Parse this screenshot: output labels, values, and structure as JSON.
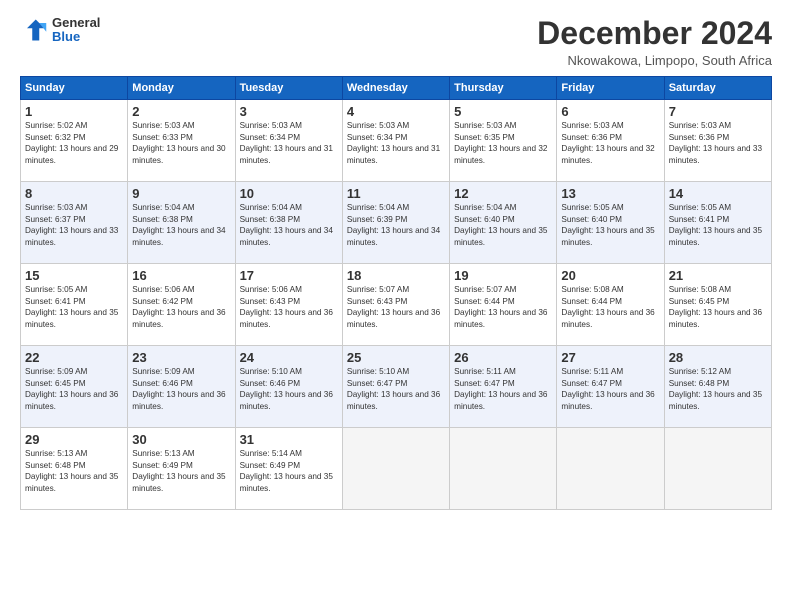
{
  "logo": {
    "general": "General",
    "blue": "Blue"
  },
  "title": "December 2024",
  "location": "Nkowakowa, Limpopo, South Africa",
  "headers": [
    "Sunday",
    "Monday",
    "Tuesday",
    "Wednesday",
    "Thursday",
    "Friday",
    "Saturday"
  ],
  "weeks": [
    [
      {
        "day": "1",
        "sunrise": "Sunrise: 5:02 AM",
        "sunset": "Sunset: 6:32 PM",
        "daylight": "Daylight: 13 hours and 29 minutes."
      },
      {
        "day": "2",
        "sunrise": "Sunrise: 5:03 AM",
        "sunset": "Sunset: 6:33 PM",
        "daylight": "Daylight: 13 hours and 30 minutes."
      },
      {
        "day": "3",
        "sunrise": "Sunrise: 5:03 AM",
        "sunset": "Sunset: 6:34 PM",
        "daylight": "Daylight: 13 hours and 31 minutes."
      },
      {
        "day": "4",
        "sunrise": "Sunrise: 5:03 AM",
        "sunset": "Sunset: 6:34 PM",
        "daylight": "Daylight: 13 hours and 31 minutes."
      },
      {
        "day": "5",
        "sunrise": "Sunrise: 5:03 AM",
        "sunset": "Sunset: 6:35 PM",
        "daylight": "Daylight: 13 hours and 32 minutes."
      },
      {
        "day": "6",
        "sunrise": "Sunrise: 5:03 AM",
        "sunset": "Sunset: 6:36 PM",
        "daylight": "Daylight: 13 hours and 32 minutes."
      },
      {
        "day": "7",
        "sunrise": "Sunrise: 5:03 AM",
        "sunset": "Sunset: 6:36 PM",
        "daylight": "Daylight: 13 hours and 33 minutes."
      }
    ],
    [
      {
        "day": "8",
        "sunrise": "Sunrise: 5:03 AM",
        "sunset": "Sunset: 6:37 PM",
        "daylight": "Daylight: 13 hours and 33 minutes."
      },
      {
        "day": "9",
        "sunrise": "Sunrise: 5:04 AM",
        "sunset": "Sunset: 6:38 PM",
        "daylight": "Daylight: 13 hours and 34 minutes."
      },
      {
        "day": "10",
        "sunrise": "Sunrise: 5:04 AM",
        "sunset": "Sunset: 6:38 PM",
        "daylight": "Daylight: 13 hours and 34 minutes."
      },
      {
        "day": "11",
        "sunrise": "Sunrise: 5:04 AM",
        "sunset": "Sunset: 6:39 PM",
        "daylight": "Daylight: 13 hours and 34 minutes."
      },
      {
        "day": "12",
        "sunrise": "Sunrise: 5:04 AM",
        "sunset": "Sunset: 6:40 PM",
        "daylight": "Daylight: 13 hours and 35 minutes."
      },
      {
        "day": "13",
        "sunrise": "Sunrise: 5:05 AM",
        "sunset": "Sunset: 6:40 PM",
        "daylight": "Daylight: 13 hours and 35 minutes."
      },
      {
        "day": "14",
        "sunrise": "Sunrise: 5:05 AM",
        "sunset": "Sunset: 6:41 PM",
        "daylight": "Daylight: 13 hours and 35 minutes."
      }
    ],
    [
      {
        "day": "15",
        "sunrise": "Sunrise: 5:05 AM",
        "sunset": "Sunset: 6:41 PM",
        "daylight": "Daylight: 13 hours and 35 minutes."
      },
      {
        "day": "16",
        "sunrise": "Sunrise: 5:06 AM",
        "sunset": "Sunset: 6:42 PM",
        "daylight": "Daylight: 13 hours and 36 minutes."
      },
      {
        "day": "17",
        "sunrise": "Sunrise: 5:06 AM",
        "sunset": "Sunset: 6:43 PM",
        "daylight": "Daylight: 13 hours and 36 minutes."
      },
      {
        "day": "18",
        "sunrise": "Sunrise: 5:07 AM",
        "sunset": "Sunset: 6:43 PM",
        "daylight": "Daylight: 13 hours and 36 minutes."
      },
      {
        "day": "19",
        "sunrise": "Sunrise: 5:07 AM",
        "sunset": "Sunset: 6:44 PM",
        "daylight": "Daylight: 13 hours and 36 minutes."
      },
      {
        "day": "20",
        "sunrise": "Sunrise: 5:08 AM",
        "sunset": "Sunset: 6:44 PM",
        "daylight": "Daylight: 13 hours and 36 minutes."
      },
      {
        "day": "21",
        "sunrise": "Sunrise: 5:08 AM",
        "sunset": "Sunset: 6:45 PM",
        "daylight": "Daylight: 13 hours and 36 minutes."
      }
    ],
    [
      {
        "day": "22",
        "sunrise": "Sunrise: 5:09 AM",
        "sunset": "Sunset: 6:45 PM",
        "daylight": "Daylight: 13 hours and 36 minutes."
      },
      {
        "day": "23",
        "sunrise": "Sunrise: 5:09 AM",
        "sunset": "Sunset: 6:46 PM",
        "daylight": "Daylight: 13 hours and 36 minutes."
      },
      {
        "day": "24",
        "sunrise": "Sunrise: 5:10 AM",
        "sunset": "Sunset: 6:46 PM",
        "daylight": "Daylight: 13 hours and 36 minutes."
      },
      {
        "day": "25",
        "sunrise": "Sunrise: 5:10 AM",
        "sunset": "Sunset: 6:47 PM",
        "daylight": "Daylight: 13 hours and 36 minutes."
      },
      {
        "day": "26",
        "sunrise": "Sunrise: 5:11 AM",
        "sunset": "Sunset: 6:47 PM",
        "daylight": "Daylight: 13 hours and 36 minutes."
      },
      {
        "day": "27",
        "sunrise": "Sunrise: 5:11 AM",
        "sunset": "Sunset: 6:47 PM",
        "daylight": "Daylight: 13 hours and 36 minutes."
      },
      {
        "day": "28",
        "sunrise": "Sunrise: 5:12 AM",
        "sunset": "Sunset: 6:48 PM",
        "daylight": "Daylight: 13 hours and 35 minutes."
      }
    ],
    [
      {
        "day": "29",
        "sunrise": "Sunrise: 5:13 AM",
        "sunset": "Sunset: 6:48 PM",
        "daylight": "Daylight: 13 hours and 35 minutes."
      },
      {
        "day": "30",
        "sunrise": "Sunrise: 5:13 AM",
        "sunset": "Sunset: 6:49 PM",
        "daylight": "Daylight: 13 hours and 35 minutes."
      },
      {
        "day": "31",
        "sunrise": "Sunrise: 5:14 AM",
        "sunset": "Sunset: 6:49 PM",
        "daylight": "Daylight: 13 hours and 35 minutes."
      },
      null,
      null,
      null,
      null
    ]
  ]
}
